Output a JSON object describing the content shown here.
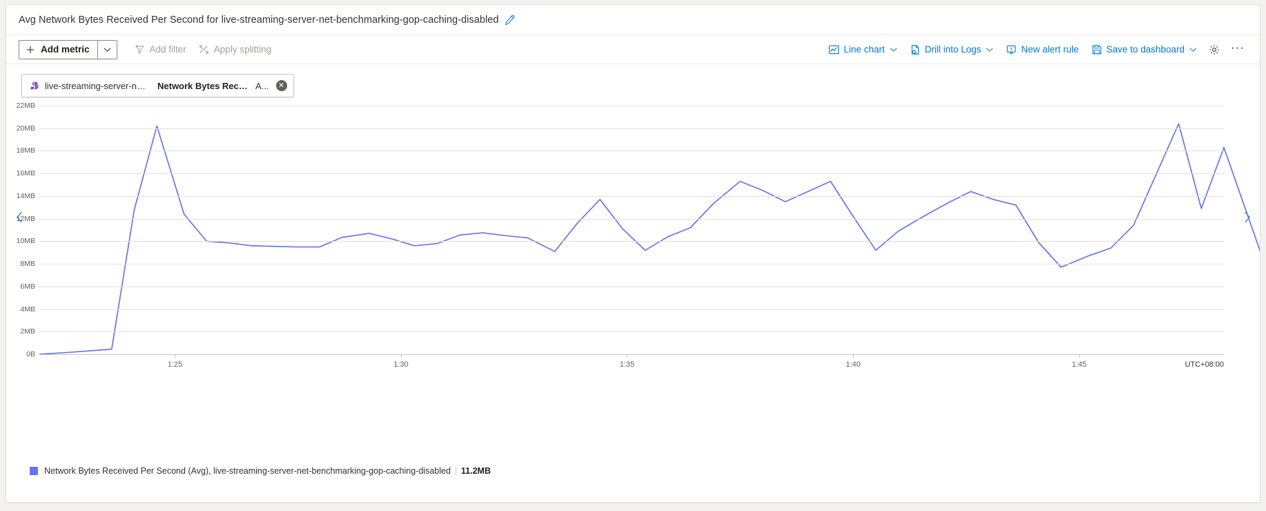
{
  "header": {
    "title": "Avg Network Bytes Received Per Second for live-streaming-server-net-benchmarking-gop-caching-disabled",
    "edit_icon": "pencil-icon"
  },
  "toolbar": {
    "add_metric_label": "Add metric",
    "add_metric_icon": "plus-icon",
    "add_metric_caret_icon": "chevron-down-icon",
    "add_filter_label": "Add filter",
    "add_filter_icon": "filter-icon",
    "apply_splitting_label": "Apply splitting",
    "apply_splitting_icon": "splitting-icon",
    "line_chart_label": "Line chart",
    "line_chart_icon": "line-chart-icon",
    "drill_into_logs_label": "Drill into Logs",
    "drill_into_logs_icon": "logs-icon",
    "new_alert_rule_label": "New alert rule",
    "new_alert_rule_icon": "alert-bell-icon",
    "save_to_dashboard_label": "Save to dashboard",
    "save_to_dashboard_icon": "save-disk-icon",
    "settings_icon": "gear-icon",
    "more_label": "···"
  },
  "metric_chip": {
    "resource_icon": "azure-resource-icon",
    "resource": "live-streaming-server-net-...",
    "metric": "Network Bytes Receive...",
    "aggregation": "A...",
    "close_icon": "close-icon",
    "close_glyph": "✕"
  },
  "chart_nav": {
    "prev_icon": "chevron-left-icon",
    "next_icon": "chevron-right-icon"
  },
  "legend": {
    "color": "#6576e8",
    "label": "Network Bytes Received Per Second (Avg), live-streaming-server-net-benchmarking-gop-caching-disabled",
    "value": "11.2MB"
  },
  "chart_data": {
    "type": "line",
    "title": "Avg Network Bytes Received Per Second for live-streaming-server-net-benchmarking-gop-caching-disabled",
    "xlabel": "",
    "ylabel": "",
    "timezone": "UTC+08:00",
    "grid": true,
    "legend_position": "bottom",
    "ylim": [
      0,
      22
    ],
    "yunit": "MB",
    "yticks": [
      0,
      2,
      4,
      6,
      8,
      10,
      12,
      14,
      16,
      18,
      20,
      22
    ],
    "ytick_labels": [
      "0B",
      "2MB",
      "4MB",
      "6MB",
      "8MB",
      "10MB",
      "12MB",
      "14MB",
      "16MB",
      "18MB",
      "20MB",
      "22MB"
    ],
    "xlim": [
      82.0,
      108.2
    ],
    "xticks": [
      85,
      90,
      95,
      100,
      105
    ],
    "xtick_labels": [
      "1:25",
      "1:30",
      "1:35",
      "1:40",
      "1:45"
    ],
    "series": [
      {
        "name": "Network Bytes Received Per Second (Avg), live-streaming-server-net-benchmarking-gop-caching-disabled",
        "color": "#6576e8",
        "x": [
          82.0,
          82.6,
          83.1,
          83.6,
          84.1,
          84.6,
          85.2,
          85.7,
          86.2,
          86.7,
          87.2,
          87.7,
          88.2,
          88.7,
          89.3,
          89.8,
          90.3,
          90.8,
          91.3,
          91.8,
          92.3,
          92.8,
          93.4,
          93.9,
          94.4,
          94.9,
          95.4,
          95.9,
          96.4,
          96.9,
          97.5,
          98.0,
          98.5,
          99.0,
          99.5,
          100.0,
          100.5,
          101.0,
          101.6,
          102.1,
          102.6,
          103.1,
          103.6,
          104.1,
          104.6,
          105.2,
          105.7,
          106.2,
          106.7,
          107.2,
          107.7,
          108.2
        ],
        "y": [
          0.0,
          0.15,
          0.3,
          0.45,
          12.8,
          20.2,
          12.4,
          10.0,
          9.85,
          9.6,
          9.55,
          9.5,
          9.5,
          10.35,
          10.7,
          10.2,
          9.6,
          9.8,
          10.55,
          10.75,
          10.5,
          10.3,
          9.1,
          11.6,
          13.7,
          11.1,
          9.2,
          10.4,
          11.2,
          13.3,
          15.3,
          14.5,
          13.5,
          14.4,
          15.3,
          12.2,
          9.2,
          10.9,
          12.3,
          13.4,
          14.4,
          13.7,
          13.2,
          9.9,
          7.7,
          8.7,
          9.4,
          11.4,
          15.9,
          20.4,
          12.9,
          18.3
        ],
        "tail_x": [
          108.2,
          109.8
        ],
        "tail_y": [
          18.3,
          0.0
        ]
      }
    ]
  }
}
